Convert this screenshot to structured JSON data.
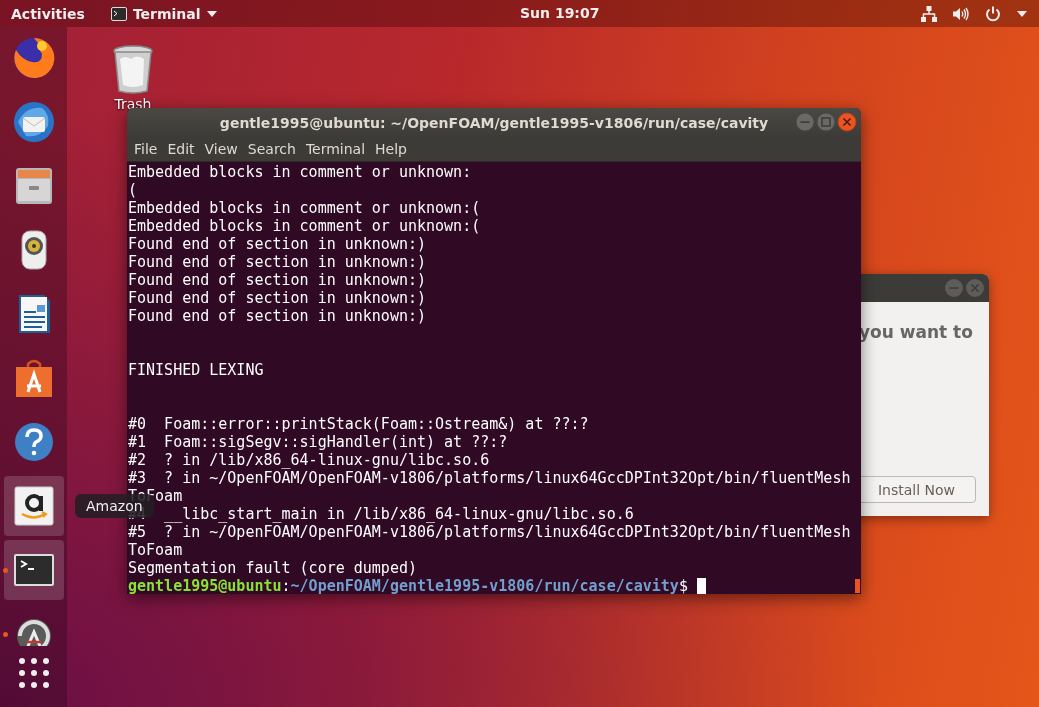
{
  "top_bar": {
    "activities": "Activities",
    "app_menu": "Terminal",
    "clock": "Sun 19:07"
  },
  "dock": {
    "items": [
      {
        "kind": "browser",
        "highlighted": false,
        "running": false
      },
      {
        "kind": "mail",
        "highlighted": false,
        "running": false
      },
      {
        "kind": "files",
        "highlighted": false,
        "running": false
      },
      {
        "kind": "music",
        "highlighted": false,
        "running": false
      },
      {
        "kind": "document",
        "highlighted": false,
        "running": false
      },
      {
        "kind": "store",
        "highlighted": false,
        "running": false
      },
      {
        "kind": "help",
        "highlighted": false,
        "running": false
      },
      {
        "kind": "shop",
        "highlighted": true,
        "running": false
      },
      {
        "kind": "terminal",
        "highlighted": true,
        "running": true
      },
      {
        "kind": "updater",
        "highlighted": false,
        "running": true
      }
    ],
    "tooltip": "Amazon"
  },
  "desktop_icons": [
    {
      "label": "Trash"
    }
  ],
  "dialog": {
    "text": "you want to",
    "button": "Install Now"
  },
  "terminal": {
    "title": "gentle1995@ubuntu: ~/OpenFOAM/gentle1995-v1806/run/case/cavity",
    "menu": [
      "File",
      "Edit",
      "View",
      "Search",
      "Terminal",
      "Help"
    ],
    "lines": [
      {
        "kind": "output",
        "text": "Embedded blocks in comment or unknown:"
      },
      {
        "kind": "output",
        "text": "("
      },
      {
        "kind": "output",
        "text": "Embedded blocks in comment or unknown:("
      },
      {
        "kind": "output",
        "text": "Embedded blocks in comment or unknown:("
      },
      {
        "kind": "output",
        "text": "Found end of section in unknown:)"
      },
      {
        "kind": "output",
        "text": "Found end of section in unknown:)"
      },
      {
        "kind": "output",
        "text": "Found end of section in unknown:)"
      },
      {
        "kind": "output",
        "text": "Found end of section in unknown:)"
      },
      {
        "kind": "output",
        "text": "Found end of section in unknown:)"
      },
      {
        "kind": "blank"
      },
      {
        "kind": "blank"
      },
      {
        "kind": "output",
        "text": "FINISHED LEXING"
      },
      {
        "kind": "blank"
      },
      {
        "kind": "blank"
      },
      {
        "kind": "output",
        "text": "#0  Foam::error::printStack(Foam::Ostream&) at ??:?"
      },
      {
        "kind": "output",
        "text": "#1  Foam::sigSegv::sigHandler(int) at ??:?"
      },
      {
        "kind": "output",
        "text": "#2  ? in /lib/x86_64-linux-gnu/libc.so.6"
      },
      {
        "kind": "output",
        "text": "#3  ? in ~/OpenFOAM/OpenFOAM-v1806/platforms/linux64GccDPInt32Opt/bin/fluentMesh"
      },
      {
        "kind": "output",
        "text": "ToFoam"
      },
      {
        "kind": "output",
        "text": "#4  __libc_start_main in /lib/x86_64-linux-gnu/libc.so.6"
      },
      {
        "kind": "output",
        "text": "#5  ? in ~/OpenFOAM/OpenFOAM-v1806/platforms/linux64GccDPInt32Opt/bin/fluentMesh"
      },
      {
        "kind": "output",
        "text": "ToFoam"
      },
      {
        "kind": "output",
        "text": "Segmentation fault (core dumped)"
      },
      {
        "kind": "prompt",
        "user": "gentle1995@ubuntu",
        "separator": ":",
        "path": "~/OpenFOAM/gentle1995-v1806/run/case/cavity",
        "symbol": "$"
      }
    ]
  }
}
